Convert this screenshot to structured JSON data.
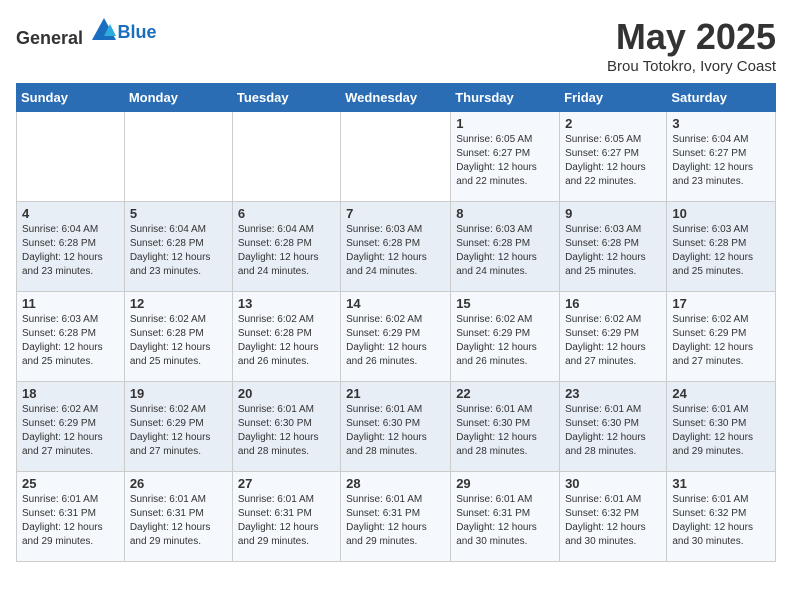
{
  "header": {
    "logo_general": "General",
    "logo_blue": "Blue",
    "title": "May 2025",
    "subtitle": "Brou Totokro, Ivory Coast"
  },
  "days_of_week": [
    "Sunday",
    "Monday",
    "Tuesday",
    "Wednesday",
    "Thursday",
    "Friday",
    "Saturday"
  ],
  "weeks": [
    [
      {
        "day": "",
        "info": ""
      },
      {
        "day": "",
        "info": ""
      },
      {
        "day": "",
        "info": ""
      },
      {
        "day": "",
        "info": ""
      },
      {
        "day": "1",
        "info": "Sunrise: 6:05 AM\nSunset: 6:27 PM\nDaylight: 12 hours\nand 22 minutes."
      },
      {
        "day": "2",
        "info": "Sunrise: 6:05 AM\nSunset: 6:27 PM\nDaylight: 12 hours\nand 22 minutes."
      },
      {
        "day": "3",
        "info": "Sunrise: 6:04 AM\nSunset: 6:27 PM\nDaylight: 12 hours\nand 23 minutes."
      }
    ],
    [
      {
        "day": "4",
        "info": "Sunrise: 6:04 AM\nSunset: 6:28 PM\nDaylight: 12 hours\nand 23 minutes."
      },
      {
        "day": "5",
        "info": "Sunrise: 6:04 AM\nSunset: 6:28 PM\nDaylight: 12 hours\nand 23 minutes."
      },
      {
        "day": "6",
        "info": "Sunrise: 6:04 AM\nSunset: 6:28 PM\nDaylight: 12 hours\nand 24 minutes."
      },
      {
        "day": "7",
        "info": "Sunrise: 6:03 AM\nSunset: 6:28 PM\nDaylight: 12 hours\nand 24 minutes."
      },
      {
        "day": "8",
        "info": "Sunrise: 6:03 AM\nSunset: 6:28 PM\nDaylight: 12 hours\nand 24 minutes."
      },
      {
        "day": "9",
        "info": "Sunrise: 6:03 AM\nSunset: 6:28 PM\nDaylight: 12 hours\nand 25 minutes."
      },
      {
        "day": "10",
        "info": "Sunrise: 6:03 AM\nSunset: 6:28 PM\nDaylight: 12 hours\nand 25 minutes."
      }
    ],
    [
      {
        "day": "11",
        "info": "Sunrise: 6:03 AM\nSunset: 6:28 PM\nDaylight: 12 hours\nand 25 minutes."
      },
      {
        "day": "12",
        "info": "Sunrise: 6:02 AM\nSunset: 6:28 PM\nDaylight: 12 hours\nand 25 minutes."
      },
      {
        "day": "13",
        "info": "Sunrise: 6:02 AM\nSunset: 6:28 PM\nDaylight: 12 hours\nand 26 minutes."
      },
      {
        "day": "14",
        "info": "Sunrise: 6:02 AM\nSunset: 6:29 PM\nDaylight: 12 hours\nand 26 minutes."
      },
      {
        "day": "15",
        "info": "Sunrise: 6:02 AM\nSunset: 6:29 PM\nDaylight: 12 hours\nand 26 minutes."
      },
      {
        "day": "16",
        "info": "Sunrise: 6:02 AM\nSunset: 6:29 PM\nDaylight: 12 hours\nand 27 minutes."
      },
      {
        "day": "17",
        "info": "Sunrise: 6:02 AM\nSunset: 6:29 PM\nDaylight: 12 hours\nand 27 minutes."
      }
    ],
    [
      {
        "day": "18",
        "info": "Sunrise: 6:02 AM\nSunset: 6:29 PM\nDaylight: 12 hours\nand 27 minutes."
      },
      {
        "day": "19",
        "info": "Sunrise: 6:02 AM\nSunset: 6:29 PM\nDaylight: 12 hours\nand 27 minutes."
      },
      {
        "day": "20",
        "info": "Sunrise: 6:01 AM\nSunset: 6:30 PM\nDaylight: 12 hours\nand 28 minutes."
      },
      {
        "day": "21",
        "info": "Sunrise: 6:01 AM\nSunset: 6:30 PM\nDaylight: 12 hours\nand 28 minutes."
      },
      {
        "day": "22",
        "info": "Sunrise: 6:01 AM\nSunset: 6:30 PM\nDaylight: 12 hours\nand 28 minutes."
      },
      {
        "day": "23",
        "info": "Sunrise: 6:01 AM\nSunset: 6:30 PM\nDaylight: 12 hours\nand 28 minutes."
      },
      {
        "day": "24",
        "info": "Sunrise: 6:01 AM\nSunset: 6:30 PM\nDaylight: 12 hours\nand 29 minutes."
      }
    ],
    [
      {
        "day": "25",
        "info": "Sunrise: 6:01 AM\nSunset: 6:31 PM\nDaylight: 12 hours\nand 29 minutes."
      },
      {
        "day": "26",
        "info": "Sunrise: 6:01 AM\nSunset: 6:31 PM\nDaylight: 12 hours\nand 29 minutes."
      },
      {
        "day": "27",
        "info": "Sunrise: 6:01 AM\nSunset: 6:31 PM\nDaylight: 12 hours\nand 29 minutes."
      },
      {
        "day": "28",
        "info": "Sunrise: 6:01 AM\nSunset: 6:31 PM\nDaylight: 12 hours\nand 29 minutes."
      },
      {
        "day": "29",
        "info": "Sunrise: 6:01 AM\nSunset: 6:31 PM\nDaylight: 12 hours\nand 30 minutes."
      },
      {
        "day": "30",
        "info": "Sunrise: 6:01 AM\nSunset: 6:32 PM\nDaylight: 12 hours\nand 30 minutes."
      },
      {
        "day": "31",
        "info": "Sunrise: 6:01 AM\nSunset: 6:32 PM\nDaylight: 12 hours\nand 30 minutes."
      }
    ]
  ]
}
